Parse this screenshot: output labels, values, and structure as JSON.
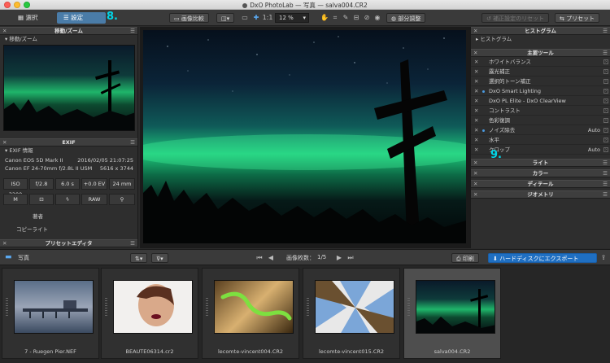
{
  "window": {
    "title": "DxO PhotoLab — 写真 — salva004.CR2"
  },
  "toolbar": {
    "select_tab": "選択",
    "customize_tab": "設定",
    "compare_label": "画像比較",
    "zoom_label": "1:1",
    "zoom_value": "12 %",
    "local_adjust_label": "部分調整",
    "reset_correction_label": "補正設定のリセット",
    "preset_label": "プリセット"
  },
  "annotations": {
    "step8": "8.",
    "step9": "9."
  },
  "left_panel": {
    "nav_title": "移動/ズーム",
    "nav_subtitle": "移動/ズーム",
    "exif_title": "EXIF",
    "exif_subtitle": "EXIF 情報",
    "camera": "Canon EOS 5D Mark II",
    "date": "2016/02/05 21:07:25",
    "lens": "Canon EF 24-70mm f/2.8L II USM",
    "dimensions": "5616 x 3744",
    "iso": "ISO 3200",
    "aperture": "f/2.8",
    "shutter": "6.0 s",
    "ev": "+0.0 EV",
    "focal": "24 mm",
    "mode": "M",
    "format": "RAW",
    "author_label": "著者",
    "copyright_label": "コピーライト",
    "preset_editor_title": "プリセットエディタ"
  },
  "right_panel": {
    "histogram_title": "ヒストグラム",
    "histogram_subtitle": "ヒストグラム",
    "main_tools_title": "主要ツール",
    "tools": [
      {
        "label": "ホワイトバランス",
        "value": "",
        "active": false
      },
      {
        "label": "露光補正",
        "value": "",
        "active": false
      },
      {
        "label": "選択的トーン補正",
        "value": "",
        "active": false
      },
      {
        "label": "DxO Smart Lighting",
        "value": "",
        "active": true
      },
      {
        "label": "DxO PL Elite - DxO ClearView",
        "value": "",
        "active": false
      },
      {
        "label": "コントラスト",
        "value": "",
        "active": false
      },
      {
        "label": "色彩復調",
        "value": "",
        "active": false
      },
      {
        "label": "ノイズ除去",
        "value": "Auto",
        "active": true
      },
      {
        "label": "水平",
        "value": "",
        "active": false
      },
      {
        "label": "クロップ",
        "value": "Auto",
        "active": false
      }
    ],
    "sections": [
      "ライト",
      "カラー",
      "ディテール",
      "ジオメトリ"
    ]
  },
  "filmbar": {
    "folder_label": "写真",
    "image_count_label": "画像枚数：",
    "image_count": "1/5",
    "print_label": "印刷",
    "export_label": "ハードディスクにエクスポート"
  },
  "filmstrip": [
    {
      "name": "7 - Ruegen Pier.NEF",
      "selected": false
    },
    {
      "name": "BEAUTE06314.cr2",
      "selected": false
    },
    {
      "name": "lecomte-vincent004.CR2",
      "selected": false
    },
    {
      "name": "lecomte-vincent015.CR2",
      "selected": false
    },
    {
      "name": "salva004.CR2",
      "selected": true
    }
  ]
}
